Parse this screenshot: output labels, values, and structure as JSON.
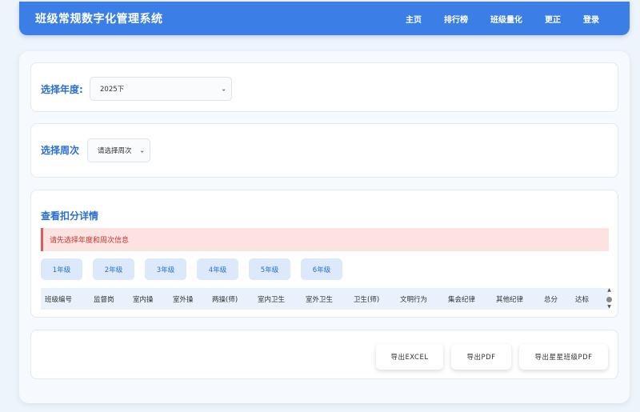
{
  "navbar": {
    "title": "班级常规数字化管理系统",
    "links": [
      "主页",
      "排行榜",
      "班级量化",
      "更正",
      "登录"
    ]
  },
  "year_section": {
    "label": "选择年度:",
    "selected": "2025下"
  },
  "week_section": {
    "label": "选择周次",
    "selected": "请选择周次"
  },
  "detail_section": {
    "title": "查看扣分详情",
    "alert": "请先选择年度和周次信息",
    "grades": [
      "1年级",
      "2年级",
      "3年级",
      "4年级",
      "5年级",
      "6年级"
    ],
    "columns": [
      "班级编号",
      "监督岗",
      "室内操",
      "室外操",
      "两操(师)",
      "室内卫生",
      "室外卫生",
      "卫生(师)",
      "文明行为",
      "集会纪律",
      "其他纪律",
      "总分",
      "达标"
    ]
  },
  "export_section": {
    "buttons": [
      "导出EXCEL",
      "导出PDF",
      "导出星星班级PDF"
    ]
  },
  "colors": {
    "primary": "#3b7fe6",
    "accent_text": "#2a6fcf",
    "alert_bg": "#fde2e2",
    "alert_text": "#c0392b"
  },
  "icons": {
    "select_arrow": "chevron-down-icon",
    "scroll": "scrollbar-arrows-icon"
  }
}
